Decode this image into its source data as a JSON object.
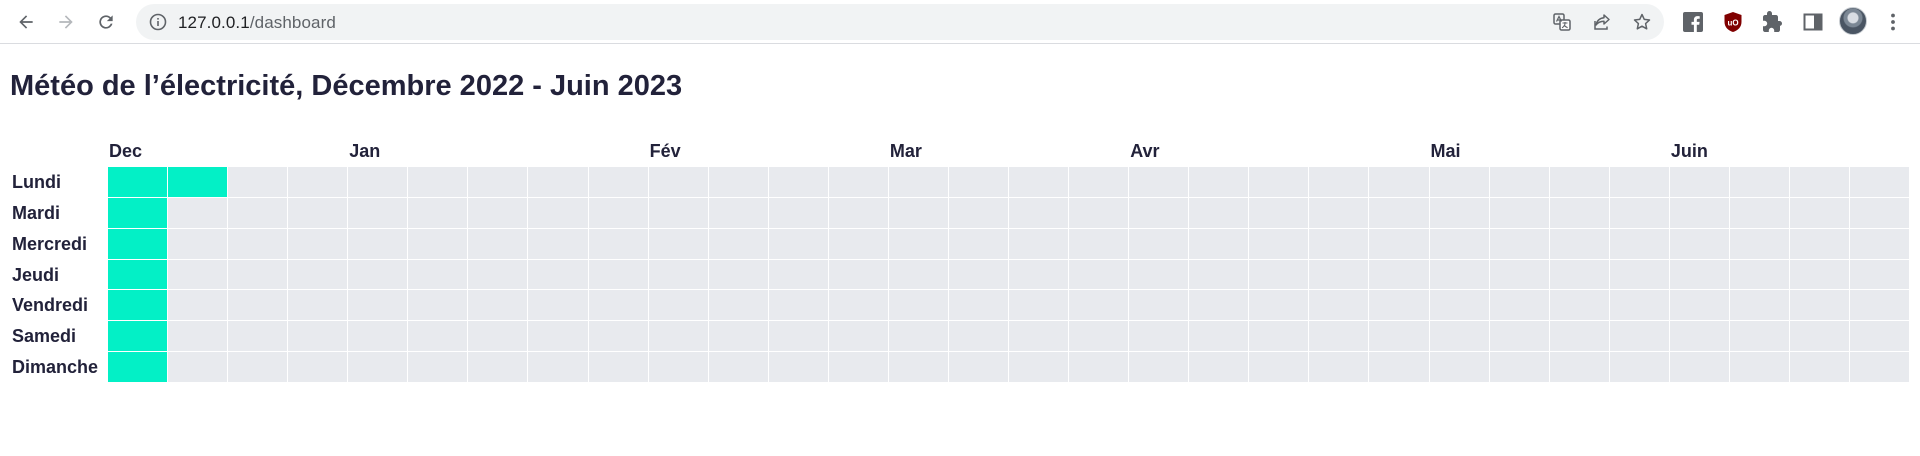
{
  "browser": {
    "url_host": "127.0.0.1",
    "url_path": "/dashboard",
    "nav_icons": [
      "back-arrow-icon",
      "forward-arrow-icon",
      "reload-icon"
    ],
    "omnibox_icons": [
      "site-info-icon",
      "translate-icon",
      "share-icon",
      "bookmark-star-icon"
    ],
    "extension_icons": [
      "facebook-extension-icon",
      "ublock-origin-icon",
      "puzzle-extensions-icon",
      "side-panel-icon"
    ],
    "menu_icon": "kebab-menu-icon"
  },
  "page": {
    "title": "Météo de l’électricité, Décembre 2022 - Juin 2023"
  },
  "calendar": {
    "months": [
      {
        "label": "Dec",
        "week_index": 0
      },
      {
        "label": "Jan",
        "week_index": 4
      },
      {
        "label": "Fév",
        "week_index": 9
      },
      {
        "label": "Mar",
        "week_index": 13
      },
      {
        "label": "Avr",
        "week_index": 17
      },
      {
        "label": "Mai",
        "week_index": 22
      },
      {
        "label": "Juin",
        "week_index": 26
      }
    ],
    "days": [
      "Lundi",
      "Mardi",
      "Mercredi",
      "Jeudi",
      "Vendredi",
      "Samedi",
      "Dimanche"
    ],
    "week_count": 30,
    "colors": {
      "filled": "#03f0c6",
      "empty": "#e8eaee"
    },
    "filled_cells": [
      {
        "week": 0,
        "day": 0
      },
      {
        "week": 1,
        "day": 0
      },
      {
        "week": 0,
        "day": 1
      },
      {
        "week": 0,
        "day": 2
      },
      {
        "week": 0,
        "day": 3
      },
      {
        "week": 0,
        "day": 4
      },
      {
        "week": 0,
        "day": 5
      },
      {
        "week": 0,
        "day": 6
      }
    ]
  }
}
